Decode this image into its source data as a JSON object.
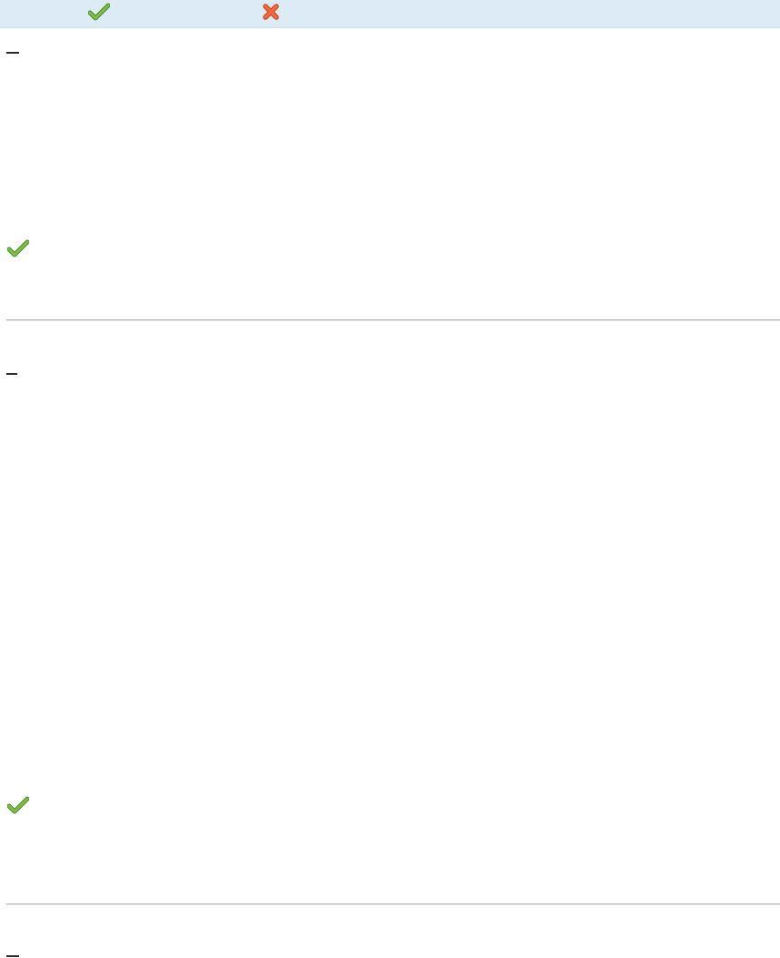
{
  "header": {
    "approve_icon": "check-icon",
    "reject_icon": "close-icon"
  },
  "entries": [
    {
      "marker": "dash",
      "status_icon": "check-icon"
    },
    {
      "marker": "dash",
      "status_icon": "check-icon"
    },
    {
      "marker": "dash"
    }
  ],
  "colors": {
    "header_background": "#dcebf6",
    "check_green": "#6aa332",
    "cross_orange": "#e2582a",
    "divider": "#b8b8b8"
  }
}
